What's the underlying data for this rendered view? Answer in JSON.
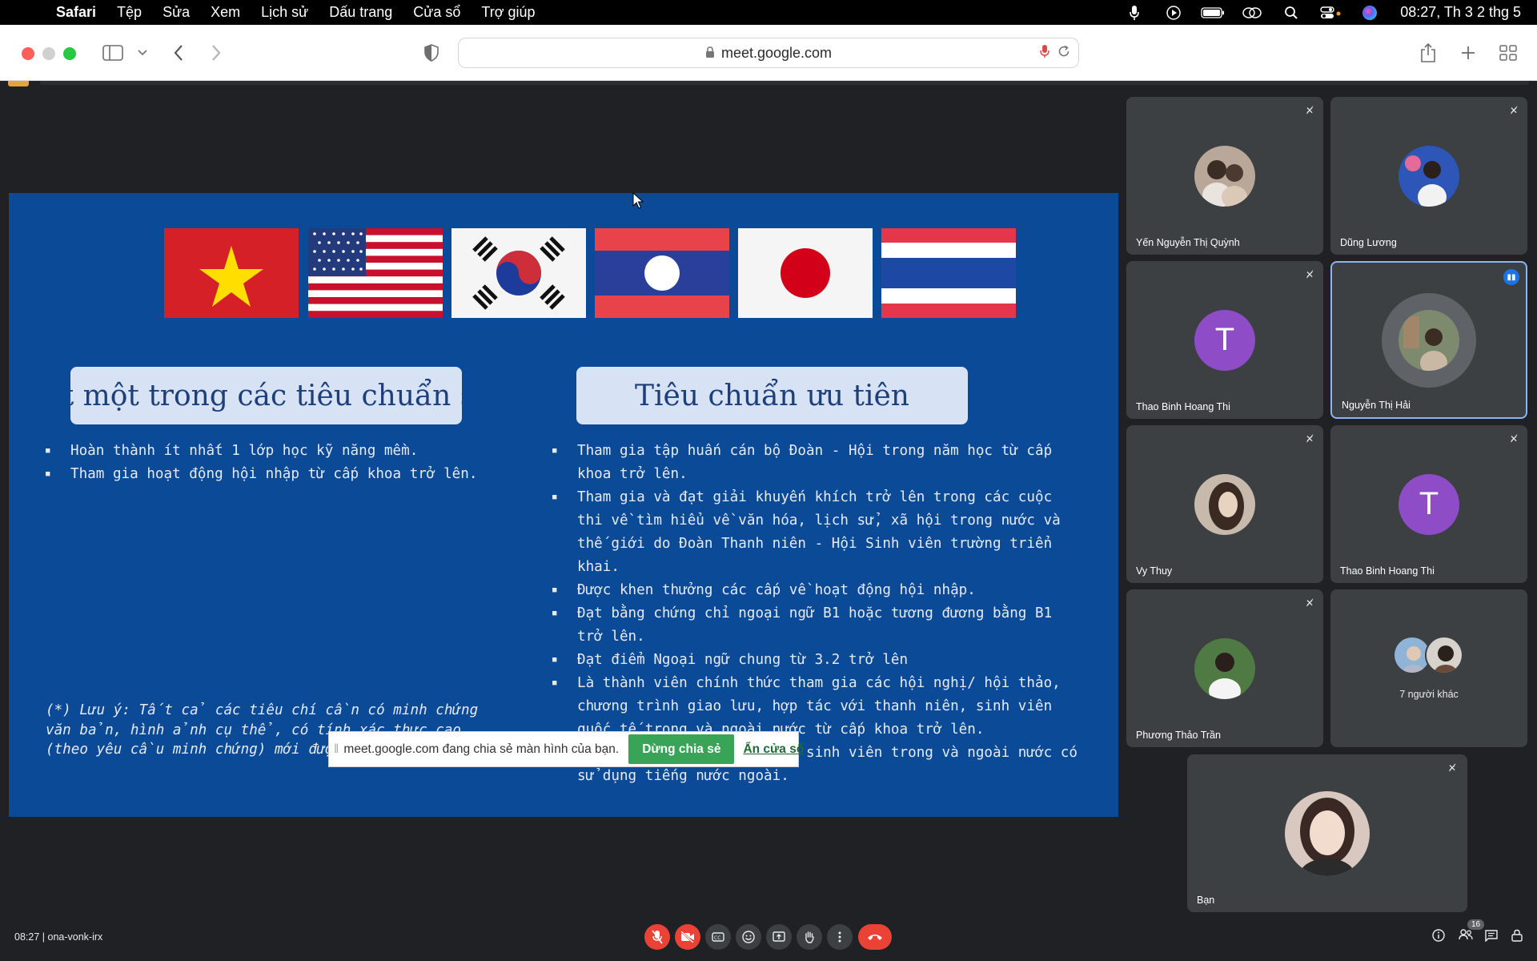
{
  "menubar": {
    "app": "Safari",
    "items": [
      "Tệp",
      "Sửa",
      "Xem",
      "Lịch sử",
      "Dấu trang",
      "Cửa sổ",
      "Trợ giúp"
    ],
    "clock": "08:27, Th 3 2 thg 5"
  },
  "browser": {
    "url": "meet.google.com"
  },
  "slide": {
    "flags": [
      "Vietnam",
      "United States",
      "South Korea",
      "Laos",
      "Japan",
      "Thailand"
    ],
    "left_heading": "Đạt một trong các tiêu chuẩn sau",
    "right_heading": "Tiêu chuẩn ưu tiên",
    "left_bullets": [
      "Hoàn thành ít nhất 1 lớp học kỹ năng mềm.",
      "Tham gia hoạt động hội nhập từ cấp khoa trở lên."
    ],
    "right_bullets": [
      "Tham gia tập huấn cán bộ Đoàn - Hội trong năm học từ cấp khoa trở lên.",
      "Tham gia và đạt giải khuyến khích trở lên trong các cuộc thi về tìm hiểu về văn hóa, lịch sử, xã hội trong nước và thế giới do Đoàn Thanh niên - Hội Sinh viên trường triển khai.",
      "Được khen thưởng các cấp về hoạt động hội nhập.",
      "Đạt bằng chứng chỉ ngoại ngữ B1 hoặc tương đương bằng B1 trở lên.",
      "Đạt điểm Ngoại ngữ chung từ 3.2 trở lên",
      "Là thành viên chính thức tham gia các hội nghị/ hội thảo, chương trình giao lưu, hợp tác với thanh niên, sinh viên quốc tế trong và ngoài nước từ cấp khoa trở lên.",
      "Tham gia tọa đàm, giao lưu sinh viên trong và ngoài nước có sử dụng tiếng nước ngoài."
    ],
    "note": "(*) Lưu ý: Tất cả các tiêu chí cần có minh chứng văn bản, hình ảnh cụ thể, có tính xác thực cao (theo yêu cầu minh chứng) mới được chấp nhận."
  },
  "share_banner": {
    "message": "meet.google.com đang chia sẻ màn hình của bạn.",
    "stop_label": "Dừng chia sẻ",
    "hide_label": "Ẩn cửa sổ"
  },
  "participants": [
    {
      "name": "Yến Nguyễn Thị Quỳnh",
      "kind": "photo",
      "color": "#b9a89a",
      "muted": true
    },
    {
      "name": "Dũng Lương",
      "kind": "photo",
      "color": "#2e56b8",
      "muted": true
    },
    {
      "name": "Thao Binh Hoang Thi",
      "kind": "letter",
      "letter": "T",
      "muted": true
    },
    {
      "name": "Nguyễn Thị Hải",
      "kind": "photo",
      "color": "#7e8a6d",
      "speaking": true
    },
    {
      "name": "Vy Thuy",
      "kind": "photo",
      "color": "#c7b9ac",
      "muted": true
    },
    {
      "name": "Thao Binh Hoang Thi",
      "kind": "letter",
      "letter": "T",
      "muted": true
    },
    {
      "name": "Phương Thảo Trần",
      "kind": "photo",
      "color": "#4f7a43",
      "muted": true
    },
    {
      "name": "7 người khác",
      "kind": "others"
    }
  ],
  "self_tile": {
    "name": "Bạn"
  },
  "meeting": {
    "time": "08:27",
    "code": "ona-vonk-irx",
    "participant_count": "16"
  },
  "icons": {
    "mute": "mic-off-icon",
    "camera": "camera-off-icon",
    "captions": "captions-icon",
    "emoji": "emoji-icon",
    "present": "present-icon",
    "hand": "raise-hand-icon",
    "more": "more-icon",
    "hangup": "hangup-icon"
  }
}
